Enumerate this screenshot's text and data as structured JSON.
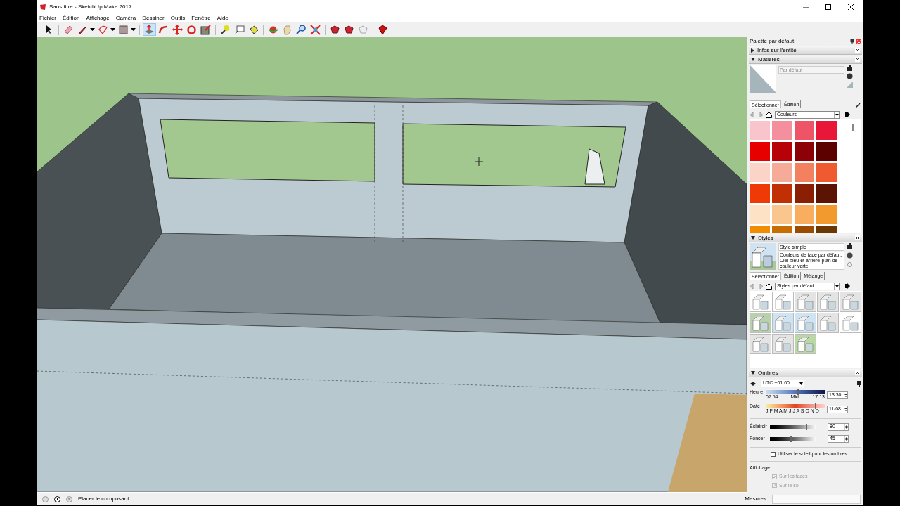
{
  "window": {
    "title": "Sans titre - SketchUp Make 2017"
  },
  "menu": [
    "Fichier",
    "Édition",
    "Affichage",
    "Caméra",
    "Dessiner",
    "Outils",
    "Fenêtre",
    "Aide"
  ],
  "toolbar": [
    {
      "kind": "select",
      "selected": false
    },
    {
      "kind": "sep"
    },
    {
      "kind": "eraser",
      "selected": false
    },
    {
      "kind": "pencil",
      "selected": false
    },
    {
      "kind": "dropdown"
    },
    {
      "kind": "arc",
      "selected": false
    },
    {
      "kind": "dropdown"
    },
    {
      "kind": "rectangle",
      "selected": false
    },
    {
      "kind": "dropdown"
    },
    {
      "kind": "sep"
    },
    {
      "kind": "pushpull",
      "selected": true
    },
    {
      "kind": "followme",
      "selected": false
    },
    {
      "kind": "move",
      "selected": false
    },
    {
      "kind": "rotate",
      "selected": false
    },
    {
      "kind": "scale",
      "selected": false
    },
    {
      "kind": "sep"
    },
    {
      "kind": "tape",
      "selected": false
    },
    {
      "kind": "text",
      "selected": false
    },
    {
      "kind": "paint",
      "selected": false
    },
    {
      "kind": "sep"
    },
    {
      "kind": "orbit",
      "selected": false
    },
    {
      "kind": "pan",
      "selected": false
    },
    {
      "kind": "zoom",
      "selected": false
    },
    {
      "kind": "extents",
      "selected": false
    },
    {
      "kind": "sep"
    },
    {
      "kind": "gem",
      "selected": false
    },
    {
      "kind": "gem",
      "selected": false
    },
    {
      "kind": "ghost",
      "selected": false
    },
    {
      "kind": "sep"
    },
    {
      "kind": "ruby",
      "selected": false
    }
  ],
  "panel": {
    "title": "Palette par défaut",
    "entity_info": {
      "title": "Infos sur l'entité",
      "expanded": false
    },
    "materials": {
      "title": "Matières",
      "expanded": true,
      "name": "Par défaut",
      "tabs": [
        {
          "label": "Sélectionner",
          "selected": true
        },
        {
          "label": "Édition",
          "selected": false
        }
      ],
      "library": "Couleurs",
      "swatches": [
        {
          "color": "#f9c4cc"
        },
        {
          "color": "#f4909d"
        },
        {
          "color": "#ef5466"
        },
        {
          "color": "#e8173a"
        },
        {
          "color": "#e60000"
        },
        {
          "color": "#b80009"
        },
        {
          "color": "#8c0008"
        },
        {
          "color": "#5c0000"
        },
        {
          "color": "#fbd4c8"
        },
        {
          "color": "#f6ab98"
        },
        {
          "color": "#f3805f"
        },
        {
          "color": "#ef5a30"
        },
        {
          "color": "#ef3a06"
        },
        {
          "color": "#c03004"
        },
        {
          "color": "#8a1f04"
        },
        {
          "color": "#5b1404"
        },
        {
          "color": "#fde2c6"
        },
        {
          "color": "#fbc68e"
        },
        {
          "color": "#f9ad5e"
        },
        {
          "color": "#f39a2f"
        },
        {
          "color": "#f08d00"
        },
        {
          "color": "#c86e00"
        },
        {
          "color": "#9a4d00"
        },
        {
          "color": "#6a3800"
        }
      ]
    },
    "styles": {
      "title": "Styles",
      "expanded": true,
      "name": "Style simple",
      "description": "Couleurs de face par défaut. Ciel bleu et arrière-plan de couleur verte.",
      "tabs": [
        {
          "label": "Sélectionner",
          "selected": true
        },
        {
          "label": "Édition",
          "selected": false
        },
        {
          "label": "Mélange",
          "selected": false
        }
      ],
      "library": "Styles par défaut",
      "thumbnails": [
        {
          "color": "#ffffff"
        },
        {
          "color": "#ffffff"
        },
        {
          "color": "#e4e4e4"
        },
        {
          "color": "#e4e4e4"
        },
        {
          "color": "#e4e4e4"
        },
        {
          "color": "#b9cfae"
        },
        {
          "color": "#cfe3f2"
        },
        {
          "color": "#cfe3f2"
        },
        {
          "color": "#e4e4e4"
        },
        {
          "color": "#ffffff"
        },
        {
          "color": "#e4e4e4"
        },
        {
          "color": "#e4e4e4"
        },
        {
          "color": "#b9d8a6"
        }
      ]
    },
    "shadows": {
      "title": "Ombres",
      "expanded": true,
      "timezone": "UTC +01:00",
      "time": {
        "label": "Heure",
        "ticks": [
          "07:54",
          "Midi",
          "17:13"
        ],
        "level": 0.55,
        "value": "13:30"
      },
      "date": {
        "label": "Date",
        "ticks": "J F M A M J J A S O N D",
        "level": 0.85,
        "value": "11/08"
      },
      "light": {
        "label": "Éclaircir",
        "level": 0.8,
        "value": "80"
      },
      "dark": {
        "label": "Foncer",
        "level": 0.45,
        "value": "45"
      },
      "use_sun": {
        "label": "Utiliser le soleil pour les ombres",
        "checked": false
      },
      "display_label": "Affichage:",
      "display": [
        {
          "label": "Sur les faces",
          "checked": true,
          "disabled": true
        },
        {
          "label": "Sur le sol",
          "checked": true,
          "disabled": true
        }
      ]
    }
  },
  "status_bar": {
    "message": "Placer le composant.",
    "measure_label": "Mesures"
  }
}
